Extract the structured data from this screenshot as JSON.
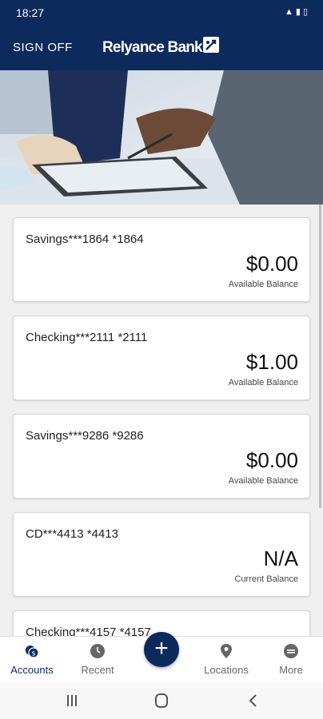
{
  "status_bar": {
    "time": "18:27",
    "icons": [
      "wifi-icon",
      "signal-icon",
      "battery-icon"
    ]
  },
  "header": {
    "sign_off": "SIGN OFF",
    "brand_name": "Relyance Bank"
  },
  "accounts": [
    {
      "name": "Savings***1864 *1864",
      "amount": "$0.00",
      "caption": "Available Balance"
    },
    {
      "name": "Checking***2111 *2111",
      "amount": "$1.00",
      "caption": "Available Balance"
    },
    {
      "name": "Savings***9286 *9286",
      "amount": "$0.00",
      "caption": "Available Balance"
    },
    {
      "name": "CD***4413 *4413",
      "amount": "N/A",
      "caption": "Current Balance"
    },
    {
      "name": "Checking***4157 *4157",
      "amount": "",
      "caption": ""
    }
  ],
  "bottom_nav": [
    {
      "label": "Accounts",
      "icon": "accounts-icon",
      "active": true
    },
    {
      "label": "Recent",
      "icon": "clock-icon",
      "active": false
    },
    {
      "label": "Locations",
      "icon": "location-pin-icon",
      "active": false
    },
    {
      "label": "More",
      "icon": "more-icon",
      "active": false
    }
  ],
  "fab_icon": "plus-icon",
  "colors": {
    "brand": "#0d2a5c",
    "background": "#efefef",
    "card": "#ffffff"
  }
}
